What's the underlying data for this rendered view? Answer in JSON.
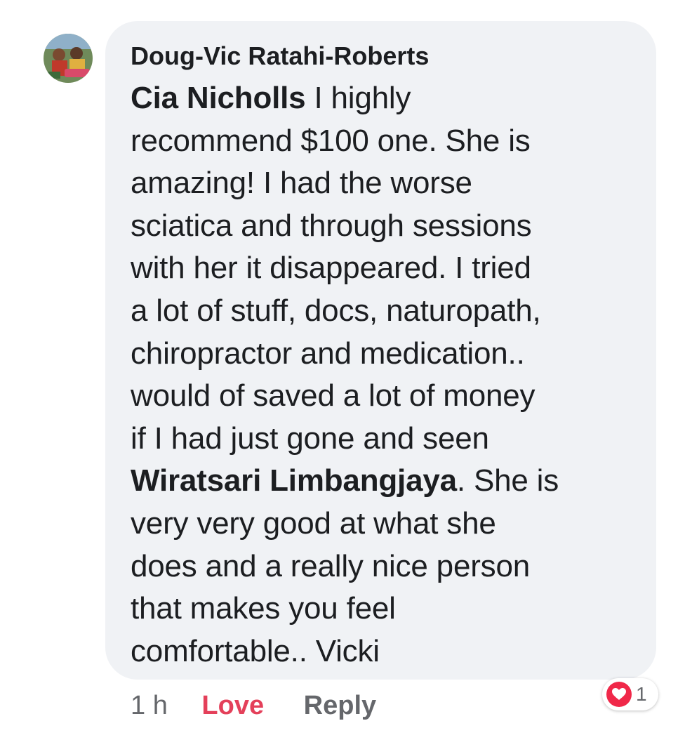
{
  "comment": {
    "author": "Doug-Vic Ratahi-Roberts",
    "avatar_icon": "profile-photo-avatar",
    "mention_first": "Cia Nicholls",
    "lines": [
      " I highly",
      "recommend $100 one. She is",
      "amazing! I had the worse",
      "sciatica and through sessions",
      "with her it disappeared. I tried",
      "a lot of stuff, docs, naturopath,",
      "chiropractor and medication..",
      "would of saved a lot of money",
      "if I had just gone and seen",
      ". She is",
      "very very good at what she",
      "does and a really nice person",
      "that makes you feel",
      "comfortable.. Vicki"
    ],
    "mention_second": "Wiratsari Limbangjaya"
  },
  "actions": {
    "time": "1 h",
    "love_label": "Love",
    "reply_label": "Reply"
  },
  "reactions": {
    "icon": "heart-icon",
    "count": "1",
    "color": "#f02849"
  },
  "colors": {
    "bubble": "#f0f2f5",
    "love": "#e4405a",
    "meta_gray": "#65676b"
  }
}
